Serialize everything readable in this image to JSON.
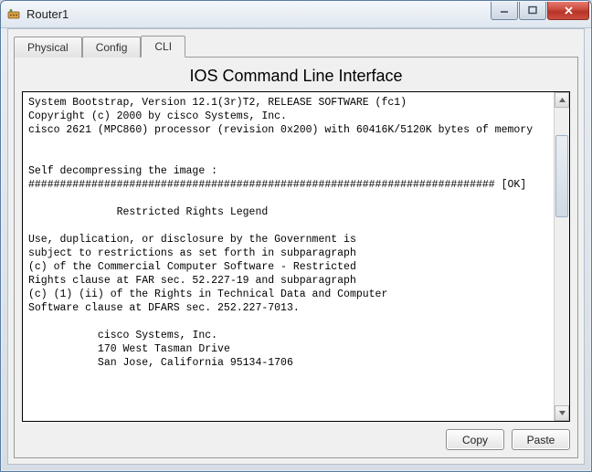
{
  "window": {
    "title": "Router1"
  },
  "tabs": {
    "physical": "Physical",
    "config": "Config",
    "cli": "CLI"
  },
  "panel": {
    "title": "IOS Command Line Interface"
  },
  "buttons": {
    "copy": "Copy",
    "paste": "Paste"
  },
  "terminal": {
    "text": "System Bootstrap, Version 12.1(3r)T2, RELEASE SOFTWARE (fc1)\nCopyright (c) 2000 by cisco Systems, Inc.\ncisco 2621 (MPC860) processor (revision 0x200) with 60416K/5120K bytes of memory\n\n\nSelf decompressing the image :\n########################################################################## [OK]\n\n              Restricted Rights Legend\n\nUse, duplication, or disclosure by the Government is\nsubject to restrictions as set forth in subparagraph\n(c) of the Commercial Computer Software - Restricted\nRights clause at FAR sec. 52.227-19 and subparagraph\n(c) (1) (ii) of the Rights in Technical Data and Computer\nSoftware clause at DFARS sec. 252.227-7013.\n\n           cisco Systems, Inc.\n           170 West Tasman Drive\n           San Jose, California 95134-1706\n\n"
  }
}
